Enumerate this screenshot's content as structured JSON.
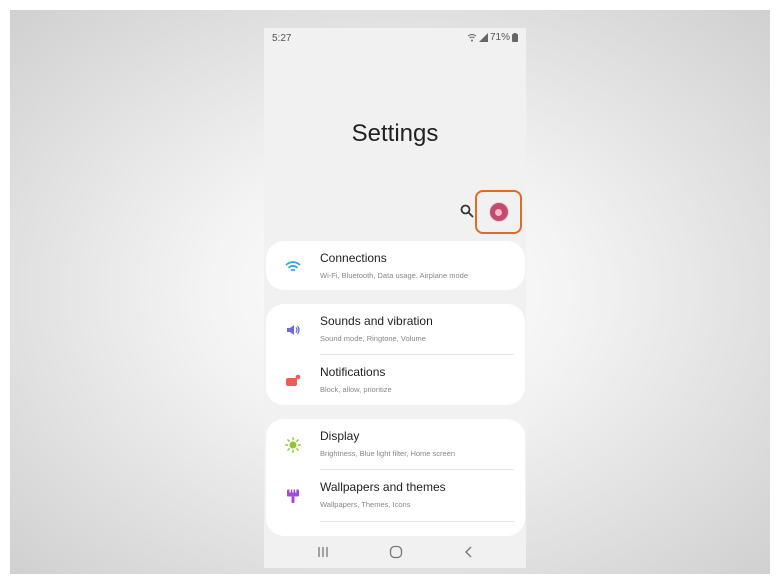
{
  "status_bar": {
    "time": "5:27",
    "battery": "71%"
  },
  "page": {
    "title": "Settings"
  },
  "toolbar": {
    "search_icon": "search-icon",
    "profile_icon": "profile-avatar-icon",
    "highlight_color": "#e06a26"
  },
  "settings": {
    "groups": [
      {
        "items": [
          {
            "label": "Connections",
            "sub": "Wi-Fi, Bluetooth, Data usage, Airplane mode",
            "icon": "wifi-icon",
            "color": "#2aa3e6"
          }
        ]
      },
      {
        "items": [
          {
            "label": "Sounds and vibration",
            "sub": "Sound mode, Ringtone, Volume",
            "icon": "speaker-icon",
            "color": "#6d6ae0"
          },
          {
            "label": "Notifications",
            "sub": "Block, allow, prioritize",
            "icon": "notification-icon",
            "color": "#ef5d55"
          }
        ]
      },
      {
        "items": [
          {
            "label": "Display",
            "sub": "Brightness, Blue light filter, Home screen",
            "icon": "sun-icon",
            "color": "#8fc62e"
          },
          {
            "label": "Wallpapers and themes",
            "sub": "Wallpapers, Themes, Icons",
            "icon": "paintbrush-icon",
            "color": "#a34bd6"
          }
        ]
      }
    ]
  },
  "navigation_bar": {
    "recents_icon": "recents-icon",
    "home_icon": "home-icon",
    "back_icon": "back-icon"
  }
}
